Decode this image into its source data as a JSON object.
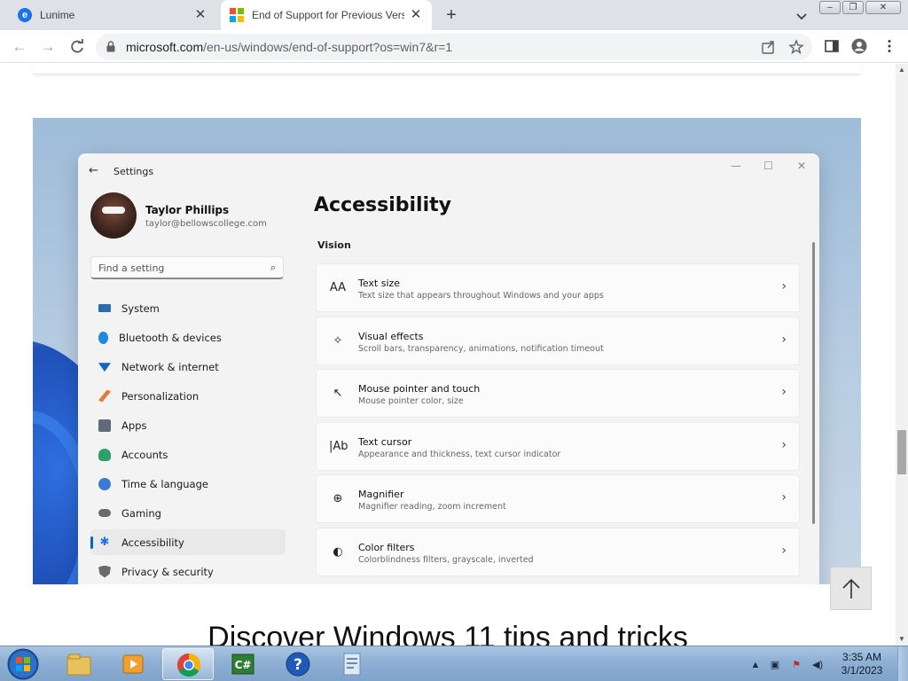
{
  "browser": {
    "tabs": [
      {
        "title": "Lunime",
        "favicon": "lunime-e-icon"
      },
      {
        "title": "End of Support for Previous Versions of Windows",
        "favicon": "microsoft-logo-icon"
      }
    ],
    "url_host": "microsoft.com",
    "url_path": "/en-us/windows/end-of-support?os=win7&r=1"
  },
  "hero": {
    "window_title": "Settings",
    "profile": {
      "name": "Taylor Phillips",
      "email": "taylor@bellowscollege.com"
    },
    "search_placeholder": "Find a setting",
    "nav": [
      {
        "label": "System",
        "icon": "monitor-icon",
        "color": "#2b6cb0"
      },
      {
        "label": "Bluetooth & devices",
        "icon": "bluetooth-icon",
        "color": "#1e88e5"
      },
      {
        "label": "Network & internet",
        "icon": "wifi-icon",
        "color": "#1565c0"
      },
      {
        "label": "Personalization",
        "icon": "brush-icon",
        "color": "#e07b39"
      },
      {
        "label": "Apps",
        "icon": "apps-icon",
        "color": "#5f6b7a"
      },
      {
        "label": "Accounts",
        "icon": "person-icon",
        "color": "#2e9e6a"
      },
      {
        "label": "Time & language",
        "icon": "globe-clock-icon",
        "color": "#3a7bd5"
      },
      {
        "label": "Gaming",
        "icon": "gamepad-icon",
        "color": "#6b6b6b"
      },
      {
        "label": "Accessibility",
        "icon": "accessibility-icon",
        "color": "#1a73e8",
        "selected": true
      },
      {
        "label": "Privacy & security",
        "icon": "shield-icon",
        "color": "#6b6b6b"
      }
    ],
    "page_title": "Accessibility",
    "section": "Vision",
    "cards": [
      {
        "title": "Text size",
        "subtitle": "Text size that appears throughout Windows and your apps",
        "icon": "text-size-icon",
        "glyph": "AA"
      },
      {
        "title": "Visual effects",
        "subtitle": "Scroll bars, transparency, animations, notification timeout",
        "icon": "sparkle-icon",
        "glyph": "✧"
      },
      {
        "title": "Mouse pointer and touch",
        "subtitle": "Mouse pointer color, size",
        "icon": "pointer-icon",
        "glyph": "↖"
      },
      {
        "title": "Text cursor",
        "subtitle": "Appearance and thickness, text cursor indicator",
        "icon": "text-cursor-icon",
        "glyph": "|Ab"
      },
      {
        "title": "Magnifier",
        "subtitle": "Magnifier reading, zoom increment",
        "icon": "magnifier-icon",
        "glyph": "⊕"
      },
      {
        "title": "Color filters",
        "subtitle": "Colorblindness filters, grayscale, inverted",
        "icon": "palette-icon",
        "glyph": "◐"
      }
    ]
  },
  "page": {
    "heading": "Discover Windows 11 tips and tricks",
    "back_to_top": "arrow-up-icon"
  },
  "taskbar": {
    "apps": [
      "file-explorer-icon",
      "media-player-icon",
      "chrome-icon",
      "csharp-icon",
      "help-icon",
      "document-icon"
    ],
    "time": "3:35 AM",
    "date": "3/1/2023"
  }
}
